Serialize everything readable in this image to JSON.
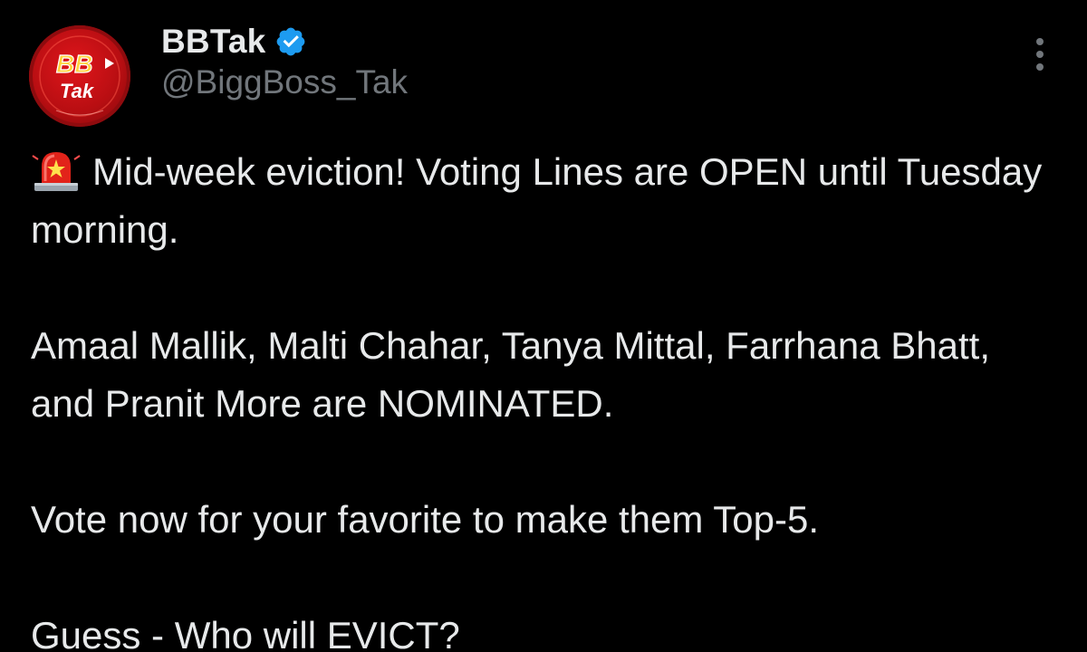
{
  "tweet": {
    "author": {
      "display_name": "BBTak",
      "handle": "@BiggBoss_Tak",
      "verified": true,
      "avatar": {
        "logo_text_top": "BB",
        "logo_text_bottom": "Tak",
        "background_color": "#c4100f"
      }
    },
    "more_icon": "more-horizontal-icon",
    "body": {
      "emoji": "police-car-light",
      "line1": "Mid-week eviction! Voting Lines are OPEN until Tuesday morning.",
      "paragraph2": "Amaal Mallik, Malti Chahar, Tanya Mittal, Farrhana Bhatt, and Pranit More are NOMINATED.",
      "paragraph3": "Vote now for your favorite to make them Top-5.",
      "paragraph4": "Guess - Who will EVICT?"
    }
  },
  "colors": {
    "background": "#000000",
    "text_primary": "#e7e9ea",
    "text_secondary": "#71767b",
    "verified_blue": "#1d9bf0"
  }
}
